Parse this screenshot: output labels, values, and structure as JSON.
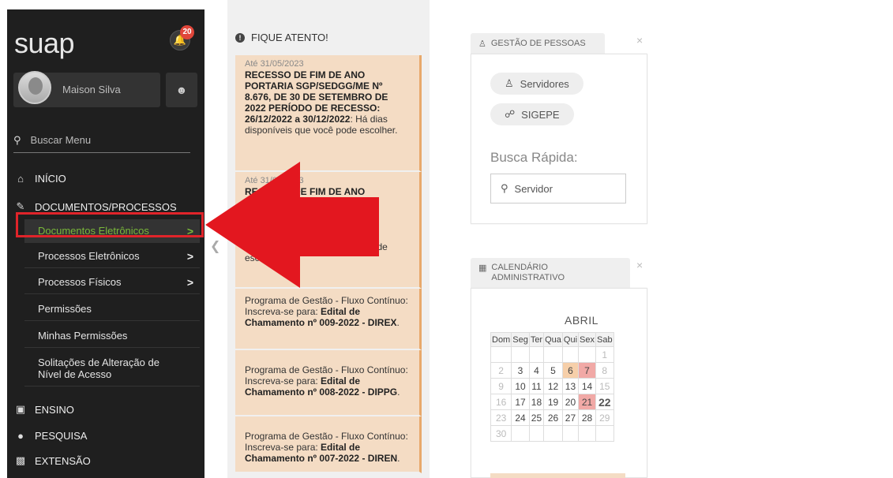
{
  "app": {
    "logo": "suap",
    "notification_count": "20"
  },
  "user": {
    "name": "Maison Silva"
  },
  "search": {
    "label": "Buscar Menu"
  },
  "menu": {
    "inicio": "INÍCIO",
    "documentos": "DOCUMENTOS/PROCESSOS",
    "sub": [
      {
        "label": "Documentos Eletrônicos",
        "chevron": ">"
      },
      {
        "label": "Processos Eletrônicos",
        "chevron": ">"
      },
      {
        "label": "Processos Físicos",
        "chevron": ">"
      },
      {
        "label": "Permissões"
      },
      {
        "label": "Minhas Permissões"
      },
      {
        "label": "Solitações de Alteração de Nível de Acesso"
      }
    ],
    "ensino": "ENSINO",
    "pesquisa": "PESQUISA",
    "extensao": "EXTENSÃO"
  },
  "notices": {
    "header": "FIQUE ATENTO!",
    "items": [
      {
        "date": "Até 31/05/2023",
        "bold": "RECESSO DE FIM DE ANO PORTARIA SGP/SEDGG/ME Nº 8.676, DE 30 DE SETEMBRO DE 2022 PERÍODO DE RECESSO: 26/12/2022 a 30/12/2022",
        "text": ": Há dias disponíveis que você pode escolher."
      },
      {
        "date": "Até 31/05/2023",
        "bold": "RECESSO DE FIM DE ANO",
        "text": "... dias disponíveis que você pode escolher."
      },
      {
        "date": "",
        "text": "Programa de Gestão - Fluxo Contínuo: Inscreva-se para: ",
        "bold": "Edital de Chamamento nº 009-2022 - DIREX",
        "tail": "."
      },
      {
        "date": "",
        "text": "Programa de Gestão - Fluxo Contínuo: Inscreva-se para: ",
        "bold": "Edital de Chamamento nº 008-2022 - DIPPG",
        "tail": "."
      },
      {
        "date": "",
        "text": "Programa de Gestão - Fluxo Contínuo: Inscreva-se para: ",
        "bold": "Edital de Chamamento nº 007-2022 - DIREN",
        "tail": "."
      }
    ]
  },
  "gestao": {
    "title": "GESTÃO DE PESSOAS",
    "close": "×",
    "btn_servidores": "Servidores",
    "btn_sigepe": "SIGEPE",
    "quick_label": "Busca Rápida:",
    "quick_placeholder": "Servidor"
  },
  "calendario": {
    "title_line1": "CALENDÁRIO",
    "title_line2": "ADMINISTRATIVO",
    "close": "×",
    "month": "ABRIL",
    "weekdays": [
      "Dom",
      "Seg",
      "Ter",
      "Qua",
      "Qui",
      "Sex",
      "Sab"
    ],
    "weeks": [
      [
        "",
        "",
        "",
        "",
        "",
        "",
        "1"
      ],
      [
        "2",
        "3",
        "4",
        "5",
        "6",
        "7",
        "8"
      ],
      [
        "9",
        "10",
        "11",
        "12",
        "13",
        "14",
        "15"
      ],
      [
        "16",
        "17",
        "18",
        "19",
        "20",
        "21",
        "22"
      ],
      [
        "23",
        "24",
        "25",
        "26",
        "27",
        "28",
        "29"
      ],
      [
        "30",
        "",
        "",
        "",
        "",
        "",
        ""
      ]
    ]
  },
  "colors": {
    "sidebar_bg": "#1f1f1f",
    "active_green": "#7ab83a",
    "highlight_red": "#e0242a",
    "notice_bg": "#f4dcc4",
    "badge_red": "#e0463a"
  }
}
